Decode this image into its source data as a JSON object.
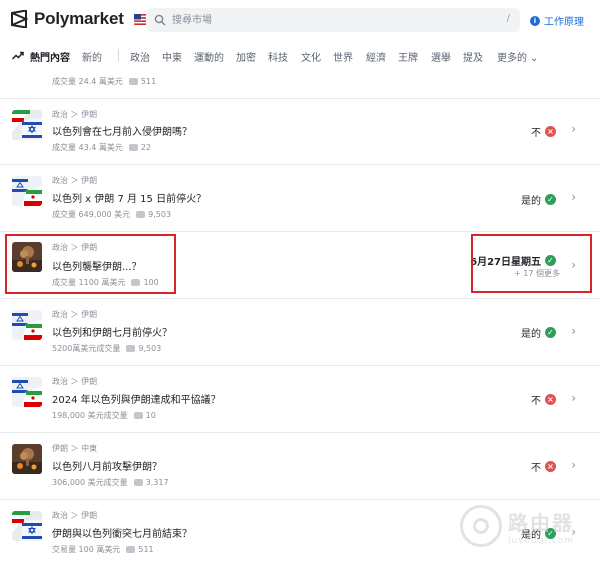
{
  "header": {
    "brand": "Polymarket",
    "search_placeholder": "搜尋市場",
    "search_shortcut": "/",
    "how_it_works": "工作原理"
  },
  "nav": {
    "items": [
      {
        "label": "熱門內容",
        "active": true
      },
      {
        "label": "新的"
      },
      {
        "label": "政治"
      },
      {
        "label": "中東"
      },
      {
        "label": "運動的"
      },
      {
        "label": "加密"
      },
      {
        "label": "科技"
      },
      {
        "label": "文化"
      },
      {
        "label": "世界"
      },
      {
        "label": "經濟"
      },
      {
        "label": "王牌"
      },
      {
        "label": "選舉"
      },
      {
        "label": "提及"
      },
      {
        "label": "更多的"
      }
    ]
  },
  "colors": {
    "accent": "#1e6bd6",
    "yes": "#2e9e5b",
    "no": "#e05252",
    "highlight": "#d3262c"
  },
  "rows": [
    {
      "category": "",
      "question": "",
      "volume": "成交量 24.4 萬美元",
      "comments": "511",
      "outcome": "",
      "outcome_icon": "",
      "thumb": "none"
    },
    {
      "category": "政治 ＞ 伊朗",
      "question": "以色列會在七月前入侵伊朗嗎？",
      "volume": "成交量 43.4 萬美元",
      "comments": "22",
      "outcome": "不",
      "outcome_icon": "no",
      "thumb": "flags"
    },
    {
      "category": "政治 ＞ 伊朗",
      "question": "以色列 x 伊朗 7 月 15 日前停火？",
      "volume": "成交量 649,000 美元",
      "comments": "9,503",
      "outcome": "是的",
      "outcome_icon": "yes",
      "thumb": "flags"
    },
    {
      "category": "政治 ＞ 伊朗",
      "question": "以色列襲擊伊朗...？",
      "volume": "成交量 1100 萬美元",
      "comments": "100",
      "outcome": "6月27日星期五",
      "outcome_icon": "yes",
      "more": "+ 17 個更多",
      "thumb": "blast"
    },
    {
      "category": "政治 ＞ 伊朗",
      "question": "以色列和伊朗七月前停火？",
      "volume": "5200萬美元成交量",
      "comments": "9,503",
      "outcome": "是的",
      "outcome_icon": "yes",
      "thumb": "flags"
    },
    {
      "category": "政治 ＞ 伊朗",
      "question": "2024 年以色列與伊朗達成和平協議？",
      "volume": "198,000 美元成交量",
      "comments": "10",
      "outcome": "不",
      "outcome_icon": "no",
      "thumb": "flags"
    },
    {
      "category": "伊朗 ＞ 中東",
      "question": "以色列八月前攻擊伊朗？",
      "volume": "306,000 美元成交量",
      "comments": "3,317",
      "outcome": "不",
      "outcome_icon": "no",
      "thumb": "blast"
    },
    {
      "category": "政治 ＞ 伊朗",
      "question": "伊朗與以色列衝突七月前結束？",
      "volume": "交易量 100 萬美元",
      "comments": "511",
      "outcome": "是的",
      "outcome_icon": "yes",
      "thumb": "flags"
    }
  ],
  "watermark": {
    "line1": "路由器",
    "line2": "luyouqi.com"
  }
}
